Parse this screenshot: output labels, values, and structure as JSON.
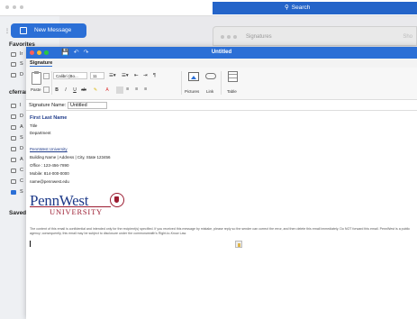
{
  "background": {
    "search_label": "Search",
    "new_message_label": "New Message",
    "sidebar": {
      "favorites_label": "Favorites",
      "account_label": "cferrar",
      "saved_label": "Saved",
      "fav_letters": [
        "Ir",
        "S",
        "D"
      ],
      "acct_letters": [
        "I",
        "D",
        "A",
        "S",
        "D",
        "A",
        "C",
        "C",
        "S"
      ]
    },
    "signatures_window": {
      "title": "Signatures",
      "right_hint": "Sho"
    }
  },
  "window": {
    "title": "Untitled",
    "ribbon_tab": "Signature",
    "ribbon": {
      "paste_label": "Paste",
      "font_name": "Calibri (Bo...",
      "font_size": "11",
      "pictures_label": "Pictures",
      "link_label": "Link",
      "table_label": "Table"
    },
    "signature_name_label": "Signature Name:",
    "signature_name_value": "Untitled"
  },
  "signature": {
    "name": "First Last Name",
    "title": "Title",
    "department": "Department",
    "university": "PennWest University",
    "address": "Building Name | Address | City, State 123456",
    "office": "Office : 123-456-7890",
    "mobile": "Mobile: 814-000-0000",
    "email": "name@pennwest.edu",
    "logo_main": "PennWest",
    "logo_sub": "UNIVERSITY",
    "disclaimer": "The content of this email is confidential and intended only for the recipient(s) specified. If you received this message by mistake, please reply so the sender can correct the error, and then delete this email immediately. Do NOT forward this email. PennWest is a public agency; consequently, this email may be subject to disclosure under the commonwealth's Right-to-Know Law."
  },
  "colors": {
    "accent": "#2b6fd6",
    "brand_blue": "#1f3b8a",
    "brand_red": "#9b1b30"
  }
}
